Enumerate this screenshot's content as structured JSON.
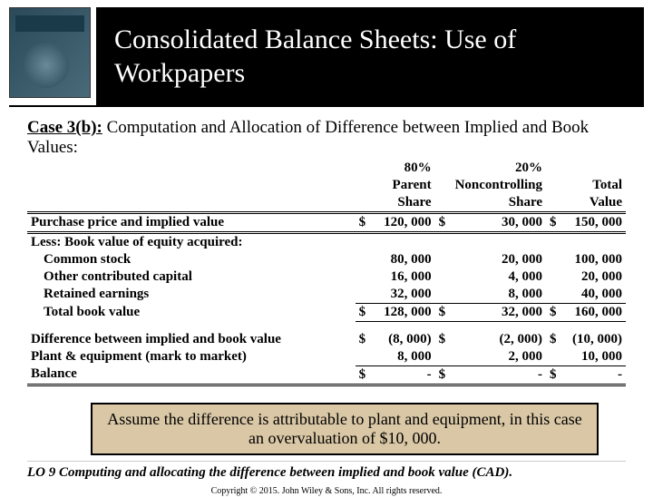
{
  "header": {
    "title": "Consolidated Balance Sheets: Use of Workpapers"
  },
  "case": {
    "label": "Case 3(b):",
    "desc": "Computation and Allocation of Difference between Implied and Book Values:"
  },
  "cols": {
    "c1_pct": "80%",
    "c1_a": "Parent",
    "c1_b": "Share",
    "c2_pct": "20%",
    "c2_a": "Noncontrolling",
    "c2_b": "Share",
    "c3_a": "Total",
    "c3_b": "Value"
  },
  "rows": {
    "r1": {
      "label": "Purchase price and implied value",
      "v1": "120, 000",
      "v2": "30, 000",
      "v3": "150, 000"
    },
    "r2": {
      "label": "Less: Book value of equity acquired:"
    },
    "r3": {
      "label": "Common stock",
      "v1": "80, 000",
      "v2": "20, 000",
      "v3": "100, 000"
    },
    "r4": {
      "label": "Other contributed capital",
      "v1": "16, 000",
      "v2": "4, 000",
      "v3": "20, 000"
    },
    "r5": {
      "label": "Retained earnings",
      "v1": "32, 000",
      "v2": "8, 000",
      "v3": "40, 000"
    },
    "r6": {
      "label": "Total book value",
      "v1": "128, 000",
      "v2": "32, 000",
      "v3": "160, 000"
    },
    "r7": {
      "label": "Difference between implied and book value",
      "v1": "(8, 000)",
      "v2": "(2, 000)",
      "v3": "(10, 000)"
    },
    "r8": {
      "label": "Plant & equipment (mark to market)",
      "v1": "8, 000",
      "v2": "2, 000",
      "v3": "10, 000"
    },
    "r9": {
      "label": "Balance",
      "v1": "-",
      "v2": "-",
      "v3": "-"
    }
  },
  "dollar": "$",
  "note": "Assume the difference is attributable to plant and equipment, in this case an overvaluation of $10, 000.",
  "lo": "LO 9  Computing and allocating the difference between implied and book value (CAD).",
  "copyright": "Copyright © 2015. John Wiley & Sons, Inc. All rights reserved.",
  "chart_data": {
    "type": "table",
    "title": "Computation and Allocation of Difference between Implied and Book Values",
    "columns": [
      "Line item",
      "80% Parent Share",
      "20% Noncontrolling Share",
      "Total Value"
    ],
    "rows": [
      [
        "Purchase price and implied value",
        120000,
        30000,
        150000
      ],
      [
        "Common stock",
        80000,
        20000,
        100000
      ],
      [
        "Other contributed capital",
        16000,
        4000,
        20000
      ],
      [
        "Retained earnings",
        32000,
        8000,
        40000
      ],
      [
        "Total book value",
        128000,
        32000,
        160000
      ],
      [
        "Difference between implied and book value",
        -8000,
        -2000,
        -10000
      ],
      [
        "Plant & equipment (mark to market)",
        8000,
        2000,
        10000
      ],
      [
        "Balance",
        0,
        0,
        0
      ]
    ]
  }
}
